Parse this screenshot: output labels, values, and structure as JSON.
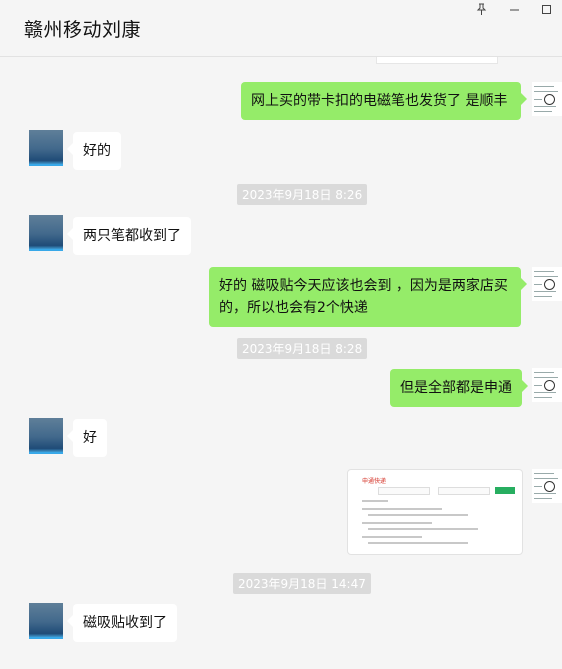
{
  "window": {
    "title": "赣州移动刘康",
    "pin_icon": "pin-icon",
    "minimize_icon": "minimize-icon",
    "maximize_icon": "maximize-icon"
  },
  "messages": [
    {
      "side": "out",
      "text": "网上买的带卡扣的电磁笔也发货了  是顺丰"
    },
    {
      "side": "in",
      "text": "好的"
    },
    {
      "type": "time",
      "text": "2023年9月18日 8:26"
    },
    {
      "side": "in",
      "text": "两只笔都收到了"
    },
    {
      "side": "out",
      "text": "好的  磁吸贴今天应该也会到 ，因为是两家店买的，所以也会有2个快递"
    },
    {
      "type": "time",
      "text": "2023年9月18日 8:28"
    },
    {
      "side": "out",
      "text": "但是全部都是申通"
    },
    {
      "side": "in",
      "text": "好"
    },
    {
      "side": "out",
      "type": "image",
      "caption": "申通快递"
    },
    {
      "type": "time",
      "text": "2023年9月18日 14:47"
    },
    {
      "side": "in",
      "text": "磁吸贴收到了"
    }
  ]
}
